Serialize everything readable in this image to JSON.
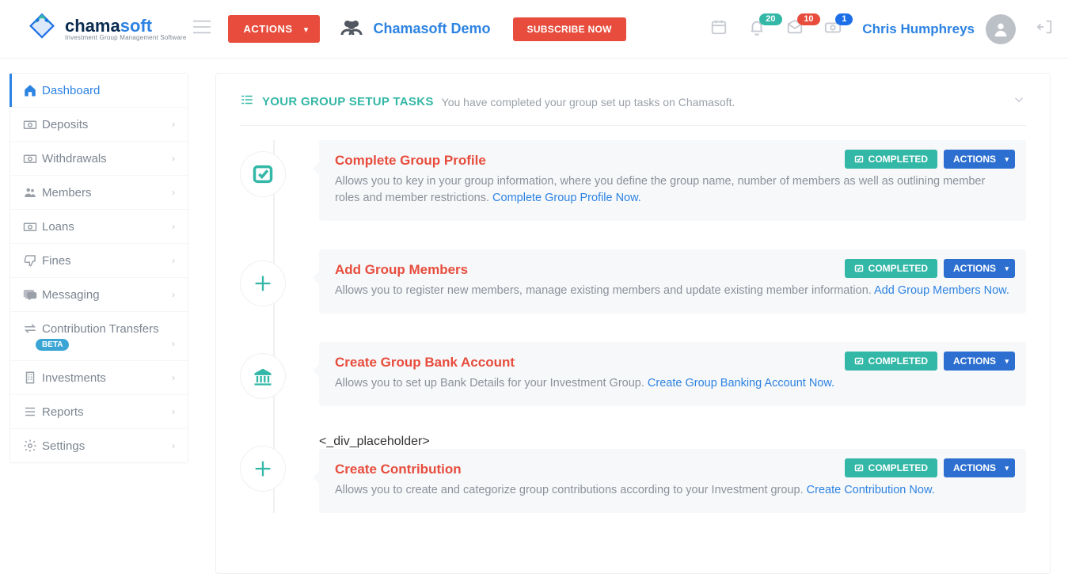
{
  "brand": {
    "name_chama": "chama",
    "name_soft": "soft",
    "tagline": "Investment Group Management Software"
  },
  "header": {
    "actions_label": "ACTIONS",
    "group_name": "Chamasoft Demo",
    "subscribe_label": "SUBSCRIBE NOW",
    "badges": {
      "bell": "20",
      "mail": "10",
      "money": "1"
    },
    "user_name": "Chris Humphreys"
  },
  "sidebar": {
    "items": [
      {
        "label": "Dashboard",
        "active": true
      },
      {
        "label": "Deposits"
      },
      {
        "label": "Withdrawals"
      },
      {
        "label": "Members"
      },
      {
        "label": "Loans"
      },
      {
        "label": "Fines"
      },
      {
        "label": "Messaging"
      },
      {
        "label": "Contribution Transfers",
        "beta": "BETA"
      },
      {
        "label": "Investments"
      },
      {
        "label": "Reports"
      },
      {
        "label": "Settings"
      }
    ]
  },
  "panel": {
    "title": "YOUR GROUP SETUP TASKS",
    "subtitle": "You have completed your group set up tasks on Chamasoft.",
    "completed_label": "COMPLETED",
    "actions_label": "ACTIONS"
  },
  "tasks": [
    {
      "title": "Complete Group Profile",
      "desc": "Allows you to key in your group information, where you define the group name, number of members as well as outlining member roles and member restrictions. ",
      "link": "Complete Group Profile Now."
    },
    {
      "title": "Add Group Members",
      "desc": "Allows you to register new members, manage existing members and update existing member information. ",
      "link": "Add Group Members Now."
    },
    {
      "title": "Create Group Bank Account",
      "desc": "Allows you to set up Bank Details for your Investment Group. ",
      "link": "Create Group Banking Account Now."
    },
    {
      "title": "Create Contribution",
      "desc": "Allows you to create and categorize group contributions according to your Investment group. ",
      "link": "Create Contribution Now."
    }
  ]
}
